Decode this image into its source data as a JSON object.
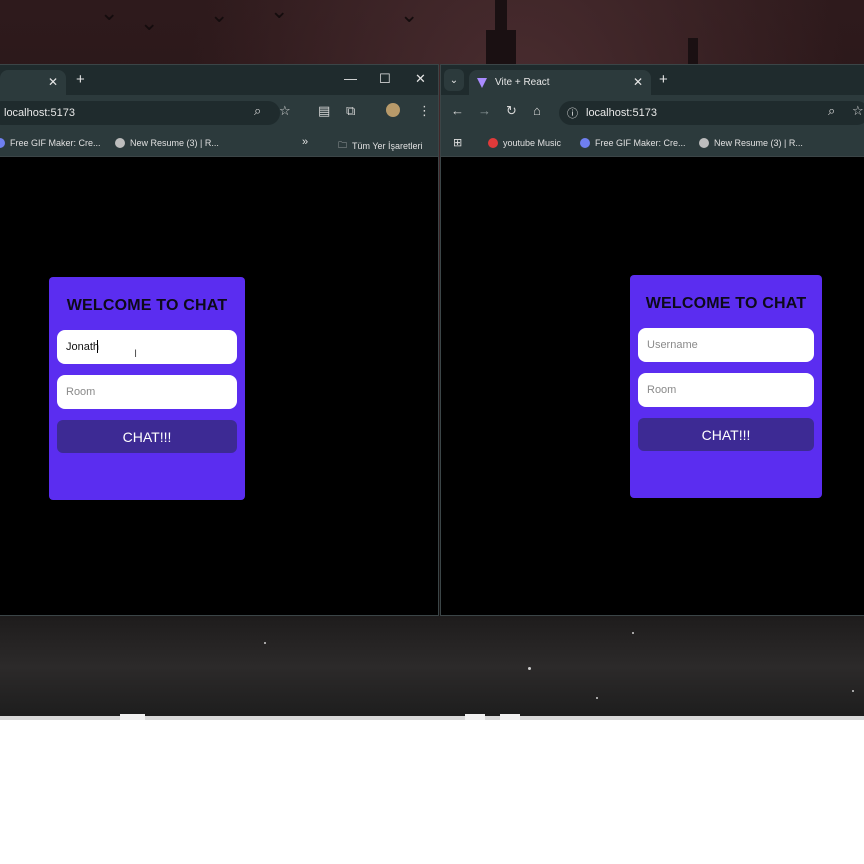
{
  "left_window": {
    "address": "localhost:5173",
    "bookmarks": [
      "Free GIF Maker: Cre...",
      "New Resume (3) | R...",
      "Tüm Yer İşaretleri"
    ],
    "chat_card": {
      "title": "WELCOME TO CHAT",
      "username_value": "Jonath",
      "username_placeholder": "Username",
      "room_placeholder": "Room",
      "button_label": "CHAT!!!"
    }
  },
  "right_window": {
    "tab_title": "Vite + React",
    "address": "localhost:5173",
    "bookmarks": [
      "youtube Music",
      "Free GIF Maker: Cre...",
      "New Resume (3) | R..."
    ],
    "chat_card": {
      "title": "WELCOME TO CHAT",
      "username_value": "",
      "username_placeholder": "Username",
      "room_placeholder": "Room",
      "button_label": "CHAT!!!"
    }
  },
  "colors": {
    "card": "#5b2df0",
    "button": "#3d2a94",
    "browser_chrome": "#2c3a3c"
  }
}
